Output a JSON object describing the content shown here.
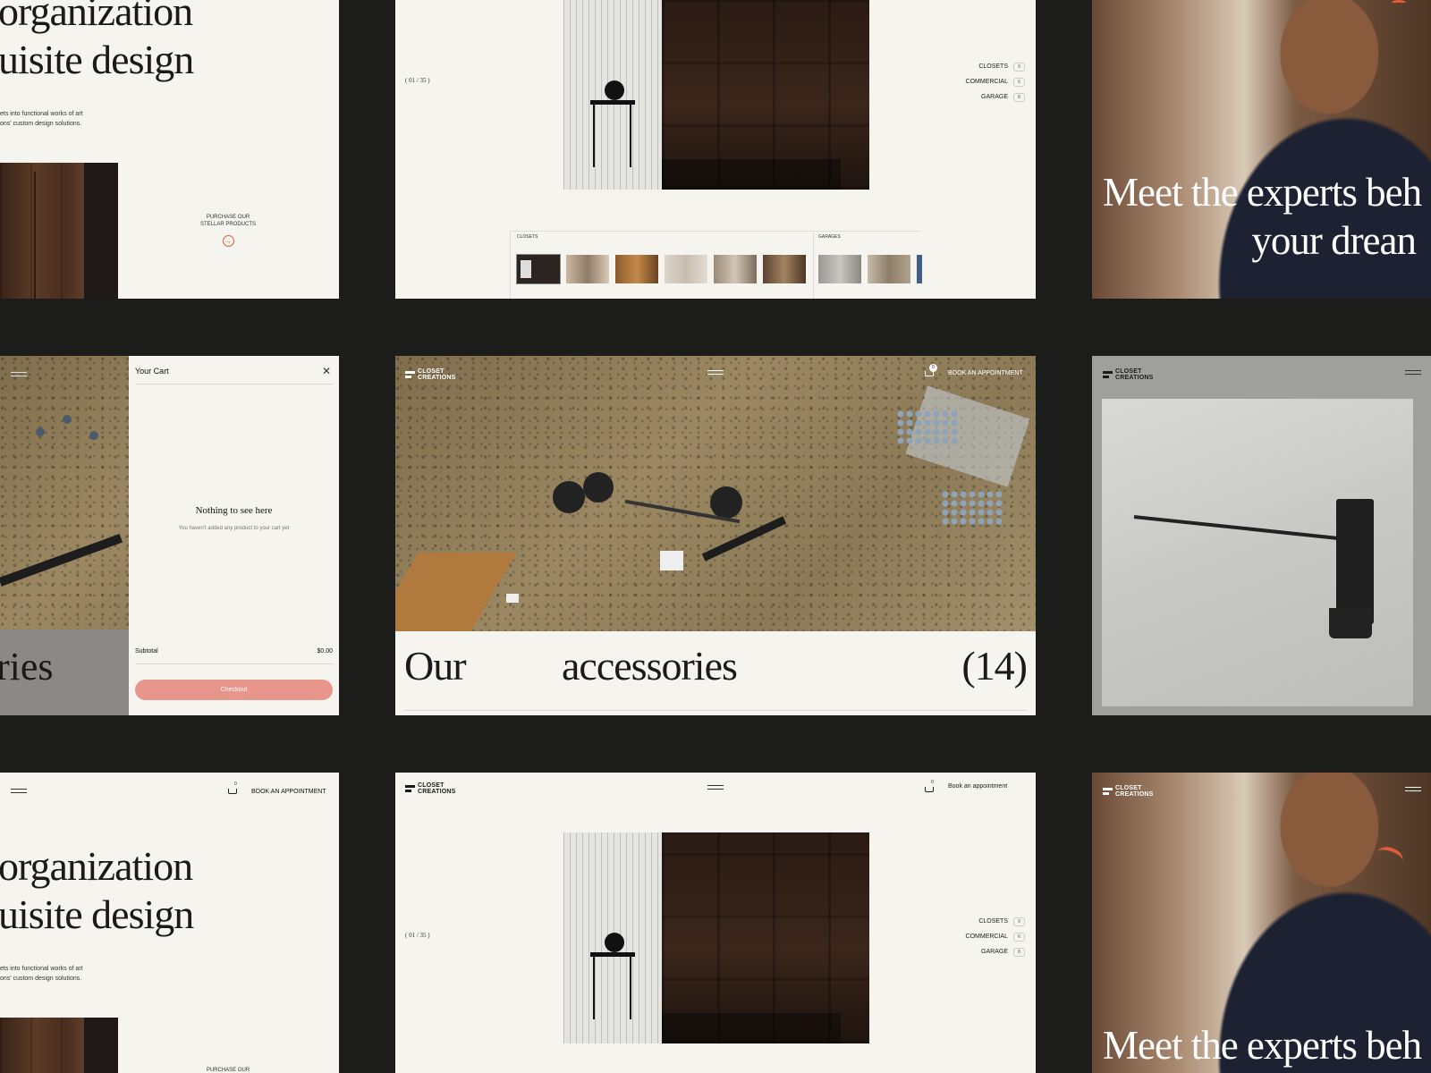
{
  "brand": {
    "logo_line1": "CLOSET",
    "logo_line2": "CREATIONS"
  },
  "hero": {
    "heading_line1": "organization",
    "heading_line2": "uisite design",
    "body_line1": "ets into functional works of art",
    "body_line2": "ons' custom design solutions.",
    "purchase_line1": "PURCHASE OUR",
    "purchase_line2": "STELLAR PRODUCTS"
  },
  "gallery": {
    "counter": "( 01 / 35 )",
    "filters": [
      {
        "label": "CLOSETS",
        "count": "9"
      },
      {
        "label": "COMMERCIAL",
        "count": "6"
      },
      {
        "label": "GARAGE",
        "count": "8"
      }
    ],
    "strip_label_closets": "CLOSETS",
    "strip_label_garages": "GARAGES"
  },
  "experts": {
    "line1": "Meet the experts beh",
    "line2": "your drean"
  },
  "cart": {
    "title": "Your Cart",
    "empty_title": "Nothing to see here",
    "empty_sub": "You haven't added any product to your cart yet",
    "subtotal_label": "Subtotal",
    "subtotal_value": "$0.00",
    "checkout": "Checkout",
    "partial_heading": "ries"
  },
  "accessories": {
    "word1": "Our",
    "word2": "accessories",
    "count": "(14)",
    "cart_count": "0",
    "book": "BOOK AN APPOINTMENT"
  },
  "nav": {
    "cart_count": "0",
    "book_caps": "BOOK AN APPOINTMENT",
    "book_lower": "Book an appointment"
  },
  "colors": {
    "page_bg": "#1c1c1b",
    "card_bg": "#f6f4ee",
    "accent": "#e35c3a",
    "checkout": "#e8968c"
  }
}
